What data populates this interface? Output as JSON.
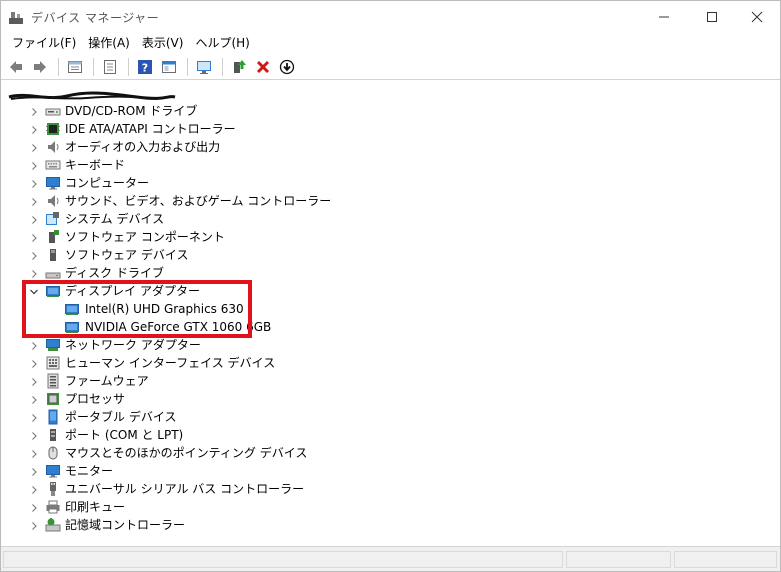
{
  "window": {
    "title": "デバイス マネージャー"
  },
  "menu": {
    "items": [
      "ファイル(F)",
      "操作(A)",
      "表示(V)",
      "ヘルプ(H)"
    ]
  },
  "toolbar": {
    "buttons": [
      "back-arrow-icon",
      "forward-arrow-icon",
      "properties-icon",
      "driver-details-icon",
      "help-icon",
      "view-icon",
      "monitor-scan-icon",
      "update-driver-icon",
      "uninstall-icon",
      "download-icon"
    ]
  },
  "tree": {
    "root_label_redacted": true,
    "categories": [
      {
        "label": "DVD/CD-ROM ドライブ",
        "icon": "dvd-drive-icon",
        "expanded": false
      },
      {
        "label": "IDE ATA/ATAPI コントローラー",
        "icon": "ide-controller-icon",
        "expanded": false
      },
      {
        "label": "オーディオの入力および出力",
        "icon": "speaker-icon",
        "expanded": false
      },
      {
        "label": "キーボード",
        "icon": "keyboard-icon",
        "expanded": false
      },
      {
        "label": "コンピューター",
        "icon": "computer-icon",
        "expanded": false
      },
      {
        "label": "サウンド、ビデオ、およびゲーム コントローラー",
        "icon": "speaker-icon",
        "expanded": false
      },
      {
        "label": "システム デバイス",
        "icon": "system-device-icon",
        "expanded": false
      },
      {
        "label": "ソフトウェア コンポーネント",
        "icon": "software-component-icon",
        "expanded": false
      },
      {
        "label": "ソフトウェア デバイス",
        "icon": "software-device-icon",
        "expanded": false
      },
      {
        "label": "ディスク ドライブ",
        "icon": "disk-drive-icon",
        "expanded": false
      },
      {
        "label": "ディスプレイ アダプター",
        "icon": "display-adapter-icon",
        "expanded": true,
        "children": [
          {
            "label": "Intel(R) UHD Graphics 630",
            "icon": "display-adapter-icon"
          },
          {
            "label": "NVIDIA GeForce GTX 1060 6GB",
            "icon": "display-adapter-icon"
          }
        ]
      },
      {
        "label": "ネットワーク アダプター",
        "icon": "network-adapter-icon",
        "expanded": false
      },
      {
        "label": "ヒューマン インターフェイス デバイス",
        "icon": "hid-icon",
        "expanded": false
      },
      {
        "label": "ファームウェア",
        "icon": "firmware-icon",
        "expanded": false
      },
      {
        "label": "プロセッサ",
        "icon": "processor-icon",
        "expanded": false
      },
      {
        "label": "ポータブル デバイス",
        "icon": "portable-device-icon",
        "expanded": false
      },
      {
        "label": "ポート (COM と LPT)",
        "icon": "port-icon",
        "expanded": false
      },
      {
        "label": "マウスとそのほかのポインティング デバイス",
        "icon": "mouse-icon",
        "expanded": false
      },
      {
        "label": "モニター",
        "icon": "monitor-icon",
        "expanded": false
      },
      {
        "label": "ユニバーサル シリアル バス コントローラー",
        "icon": "usb-icon",
        "expanded": false
      },
      {
        "label": "印刷キュー",
        "icon": "printer-icon",
        "expanded": false
      },
      {
        "label": "記憶域コントローラー",
        "icon": "storage-controller-icon",
        "expanded": false
      }
    ]
  },
  "colors": {
    "highlight": "#e0131c",
    "icon_blue": "#2f7fd1"
  }
}
